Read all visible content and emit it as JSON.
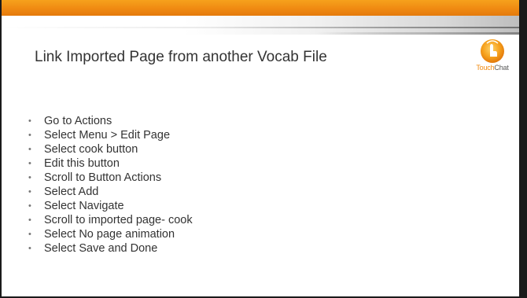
{
  "slide": {
    "title": "Link Imported Page from another Vocab File",
    "logo": {
      "brand_part1": "Touch",
      "brand_part2": "Chat",
      "icon": "touchchat-logo-icon"
    },
    "bullet_symbol": "•",
    "bullets": [
      " Go to Actions",
      "Select Menu > Edit Page",
      "Select cook button",
      "Edit this button",
      "Scroll to Button Actions",
      "Select Add",
      " Select Navigate",
      "Scroll to imported page- cook",
      "Select No page animation",
      "Select Save and Done"
    ]
  },
  "colors": {
    "accent_orange": "#f08a12",
    "title_text": "#333333",
    "background": "#ffffff"
  }
}
